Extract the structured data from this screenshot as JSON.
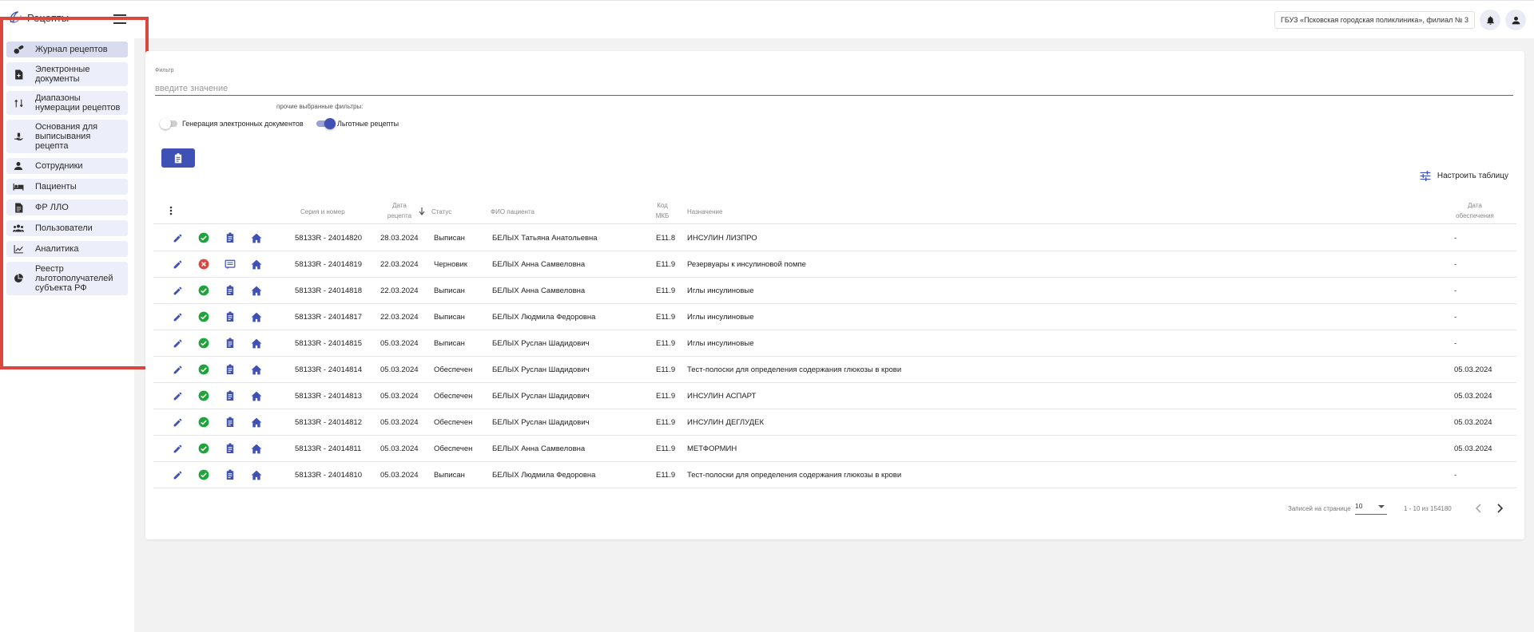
{
  "app": {
    "title": "Рецепты"
  },
  "header": {
    "organization": "ГБУЗ «Псковская городская поликлиника», филиал № 3"
  },
  "sidebar": {
    "items": [
      {
        "label": "Журнал рецептов",
        "icon": "pills-icon",
        "active": true
      },
      {
        "label": "Электронные документы",
        "icon": "document-icon"
      },
      {
        "label": "Диапазоны нумерации рецептов",
        "icon": "sort-numbers-icon"
      },
      {
        "label": "Основания для выписывания рецепта",
        "icon": "hand-basis-icon"
      },
      {
        "label": "Сотрудники",
        "icon": "person-icon"
      },
      {
        "label": "Пациенты",
        "icon": "bed-icon"
      },
      {
        "label": "ФР ЛЛО",
        "icon": "file-register-icon"
      },
      {
        "label": "Пользователи",
        "icon": "users-icon"
      },
      {
        "label": "Аналитика",
        "icon": "chart-line-icon"
      },
      {
        "label": "Реестр льготополучателей субъекта РФ",
        "icon": "pie-chart-icon"
      }
    ]
  },
  "filter": {
    "label": "Фильтр",
    "placeholder": "введите значение",
    "other_filters_label": "прочие выбранные фильтры:",
    "toggles": [
      {
        "label": "Генерация электронных документов",
        "on": false
      },
      {
        "label": "Льготные рецепты",
        "on": true
      }
    ]
  },
  "table": {
    "configure_label": "Настроить таблицу",
    "headers": {
      "series": "Серия и номер",
      "date": "Дата рецепта",
      "status": "Статус",
      "patient": "ФИО пациента",
      "code": "Код МКБ",
      "purpose": "Назначение",
      "supply_date": "Дата обеспечения"
    },
    "rows": [
      {
        "status_ok": true,
        "doc_icon": "clipboard",
        "series": "58133R - 24014820",
        "date": "28.03.2024",
        "status": "Выписан",
        "patient": "БЕЛЫХ Татьяна Анатольевна",
        "code": "E11.8",
        "purpose": "ИНСУЛИН ЛИЗПРО",
        "supply_date": "-"
      },
      {
        "status_ok": false,
        "doc_icon": "comment",
        "series": "58133R - 24014819",
        "date": "22.03.2024",
        "status": "Черновик",
        "patient": "БЕЛЫХ Анна Самвеловна",
        "code": "E11.9",
        "purpose": "Резервуары к инсулиновой помпе",
        "supply_date": "-"
      },
      {
        "status_ok": true,
        "doc_icon": "clipboard",
        "series": "58133R - 24014818",
        "date": "22.03.2024",
        "status": "Выписан",
        "patient": "БЕЛЫХ Анна Самвеловна",
        "code": "E11.9",
        "purpose": "Иглы инсулиновые",
        "supply_date": "-"
      },
      {
        "status_ok": true,
        "doc_icon": "clipboard",
        "series": "58133R - 24014817",
        "date": "22.03.2024",
        "status": "Выписан",
        "patient": "БЕЛЫХ Людмила Федоровна",
        "code": "E11.9",
        "purpose": "Иглы инсулиновые",
        "supply_date": "-"
      },
      {
        "status_ok": true,
        "doc_icon": "clipboard",
        "series": "58133R - 24014815",
        "date": "05.03.2024",
        "status": "Выписан",
        "patient": "БЕЛЫХ Руслан Шадидович",
        "code": "E11.9",
        "purpose": "Иглы инсулиновые",
        "supply_date": "-"
      },
      {
        "status_ok": true,
        "doc_icon": "clipboard",
        "series": "58133R - 24014814",
        "date": "05.03.2024",
        "status": "Обеспечен",
        "patient": "БЕЛЫХ Руслан Шадидович",
        "code": "E11.9",
        "purpose": "Тест-полоски для определения содержания глюкозы в крови",
        "supply_date": "05.03.2024"
      },
      {
        "status_ok": true,
        "doc_icon": "clipboard",
        "series": "58133R - 24014813",
        "date": "05.03.2024",
        "status": "Обеспечен",
        "patient": "БЕЛЫХ Руслан Шадидович",
        "code": "E11.9",
        "purpose": "ИНСУЛИН АСПАРТ",
        "supply_date": "05.03.2024"
      },
      {
        "status_ok": true,
        "doc_icon": "clipboard",
        "series": "58133R - 24014812",
        "date": "05.03.2024",
        "status": "Обеспечен",
        "patient": "БЕЛЫХ Руслан Шадидович",
        "code": "E11.9",
        "purpose": "ИНСУЛИН ДЕГЛУДЕК",
        "supply_date": "05.03.2024"
      },
      {
        "status_ok": true,
        "doc_icon": "clipboard",
        "series": "58133R - 24014811",
        "date": "05.03.2024",
        "status": "Обеспечен",
        "patient": "БЕЛЫХ Анна Самвеловна",
        "code": "E11.9",
        "purpose": "МЕТФОРМИН",
        "supply_date": "05.03.2024"
      },
      {
        "status_ok": true,
        "doc_icon": "clipboard",
        "series": "58133R - 24014810",
        "date": "05.03.2024",
        "status": "Выписан",
        "patient": "БЕЛЫХ Людмила Федоровна",
        "code": "E11.9",
        "purpose": "Тест-полоски для определения содержания глюкозы в крови",
        "supply_date": "-"
      }
    ]
  },
  "pagination": {
    "rows_per_page_label": "Записей на странице",
    "rows_per_page": "10",
    "range": "1 - 10 из 154180"
  },
  "colors": {
    "accent": "#3f51b5",
    "success": "#1fa33a",
    "danger": "#d9473f",
    "highlight": "#d9473f"
  }
}
